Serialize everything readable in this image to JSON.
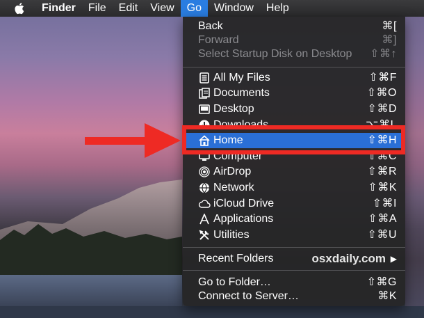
{
  "menubar": {
    "apple_icon": "apple-logo-icon",
    "items": [
      {
        "label": "Finder"
      },
      {
        "label": "File"
      },
      {
        "label": "Edit"
      },
      {
        "label": "View"
      },
      {
        "label": "Go"
      },
      {
        "label": "Window"
      },
      {
        "label": "Help"
      }
    ]
  },
  "go_menu": {
    "back": {
      "label": "Back",
      "shortcut": "⌘["
    },
    "forward": {
      "label": "Forward",
      "shortcut": "⌘]"
    },
    "startup_disk": {
      "label": "Select Startup Disk on Desktop",
      "shortcut": "⇧⌘↑"
    },
    "all_my_files": {
      "label": "All My Files",
      "shortcut": "⇧⌘F",
      "icon": "all-files-icon"
    },
    "documents": {
      "label": "Documents",
      "shortcut": "⇧⌘O",
      "icon": "documents-icon"
    },
    "desktop": {
      "label": "Desktop",
      "shortcut": "⇧⌘D",
      "icon": "desktop-icon"
    },
    "downloads": {
      "label": "Downloads",
      "shortcut": "⌥⌘L",
      "icon": "downloads-icon"
    },
    "home": {
      "label": "Home",
      "shortcut": "⇧⌘H",
      "icon": "home-icon"
    },
    "computer": {
      "label": "Computer",
      "shortcut": "⇧⌘C",
      "icon": "computer-icon"
    },
    "airdrop": {
      "label": "AirDrop",
      "shortcut": "⇧⌘R",
      "icon": "airdrop-icon"
    },
    "network": {
      "label": "Network",
      "shortcut": "⇧⌘K",
      "icon": "network-icon"
    },
    "icloud": {
      "label": "iCloud Drive",
      "shortcut": "⇧⌘I",
      "icon": "cloud-icon"
    },
    "applications": {
      "label": "Applications",
      "shortcut": "⇧⌘A",
      "icon": "applications-icon"
    },
    "utilities": {
      "label": "Utilities",
      "shortcut": "⇧⌘U",
      "icon": "utilities-icon"
    },
    "recent_folders": {
      "label": "Recent Folders",
      "arrow": "▶"
    },
    "go_to_folder": {
      "label": "Go to Folder…",
      "shortcut": "⇧⌘G"
    },
    "connect_server": {
      "label": "Connect to Server…",
      "shortcut": "⌘K"
    }
  },
  "watermark": "osxdaily.com",
  "colors": {
    "menubar_highlight": "#2a7de1",
    "menu_highlight": "#2a6fd6",
    "annotation_red": "#ee2a24"
  }
}
